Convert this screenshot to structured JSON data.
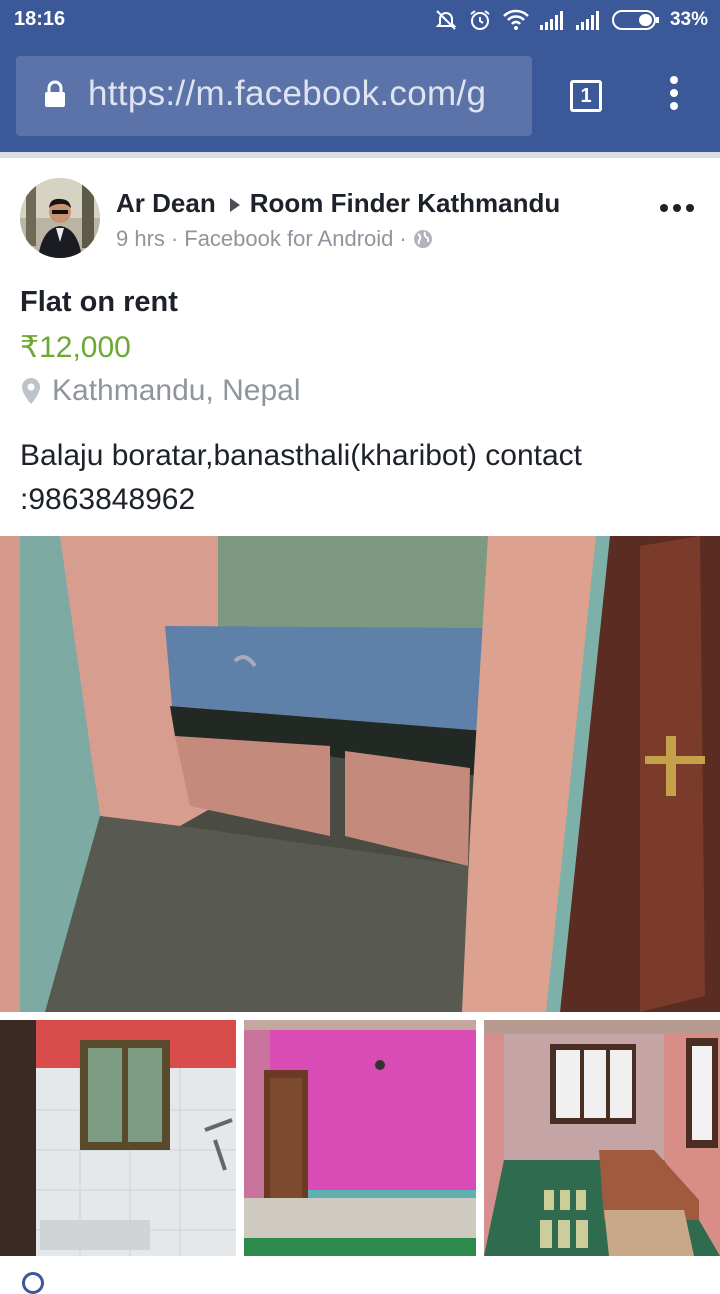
{
  "status_bar": {
    "time": "18:16",
    "battery_pct": "33%",
    "icons": [
      "mute-icon",
      "alarm-icon",
      "wifi-icon",
      "signal-icon",
      "signal-icon",
      "battery-icon"
    ]
  },
  "browser": {
    "url": "https://m.facebook.com/g",
    "tab_count": "1"
  },
  "post": {
    "author": "Ar Dean",
    "group": "Room Finder Kathmandu",
    "time": "9 hrs",
    "via": "Facebook for Android",
    "separator": "·",
    "listing": {
      "title": "Flat on rent",
      "price": "₹12,000",
      "location": "Kathmandu, Nepal",
      "description": "Balaju boratar,banasthali(kharibot) contact :9863848962"
    }
  },
  "colors": {
    "brand_blue": "#3b5998",
    "price_green": "#6ca832",
    "meta_gray": "#90949c",
    "text_dark": "#1d2129"
  }
}
